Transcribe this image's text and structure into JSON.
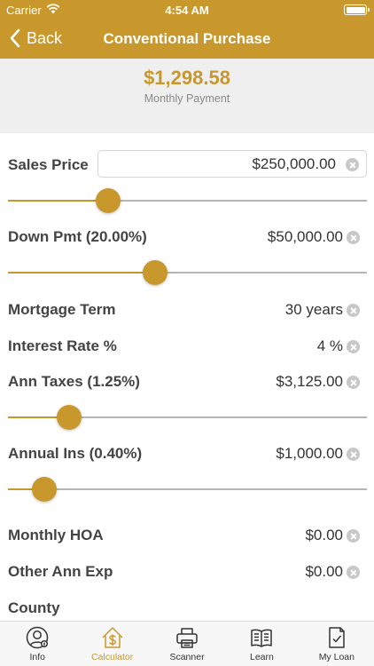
{
  "status_bar": {
    "carrier": "Carrier",
    "time": "4:54 AM"
  },
  "nav": {
    "back_label": "Back",
    "title": "Conventional Purchase"
  },
  "summary": {
    "amount": "$1,298.58",
    "label": "Monthly Payment"
  },
  "fields": {
    "sales_price": {
      "label": "Sales Price",
      "value": "$250,000.00",
      "slider_level": 0.28
    },
    "down_payment": {
      "label": "Down Pmt (20.00%)",
      "value": "$50,000.00",
      "slider_level": 0.41
    },
    "mortgage_term": {
      "label": "Mortgage Term",
      "value": "30 years"
    },
    "interest_rate": {
      "label": "Interest Rate %",
      "value": "4 %"
    },
    "ann_taxes": {
      "label": "Ann Taxes (1.25%)",
      "value": "$3,125.00",
      "slider_level": 0.17
    },
    "annual_ins": {
      "label": "Annual Ins (0.40%)",
      "value": "$1,000.00",
      "slider_level": 0.1
    },
    "monthly_hoa": {
      "label": "Monthly HOA",
      "value": "$0.00"
    },
    "other_ann_exp": {
      "label": "Other Ann Exp",
      "value": "$0.00"
    },
    "county": {
      "label": "County"
    }
  },
  "tabs": [
    {
      "label": "Info",
      "icon": "person-info-icon",
      "active": false
    },
    {
      "label": "Calculator",
      "icon": "house-dollar-icon",
      "active": true
    },
    {
      "label": "Scanner",
      "icon": "printer-icon",
      "active": false
    },
    {
      "label": "Learn",
      "icon": "book-icon",
      "active": false
    },
    {
      "label": "My Loan",
      "icon": "checklist-icon",
      "active": false
    }
  ],
  "colors": {
    "accent": "#C9982C",
    "summary_bg": "#EFEFEF",
    "track": "#B5B5B5"
  }
}
